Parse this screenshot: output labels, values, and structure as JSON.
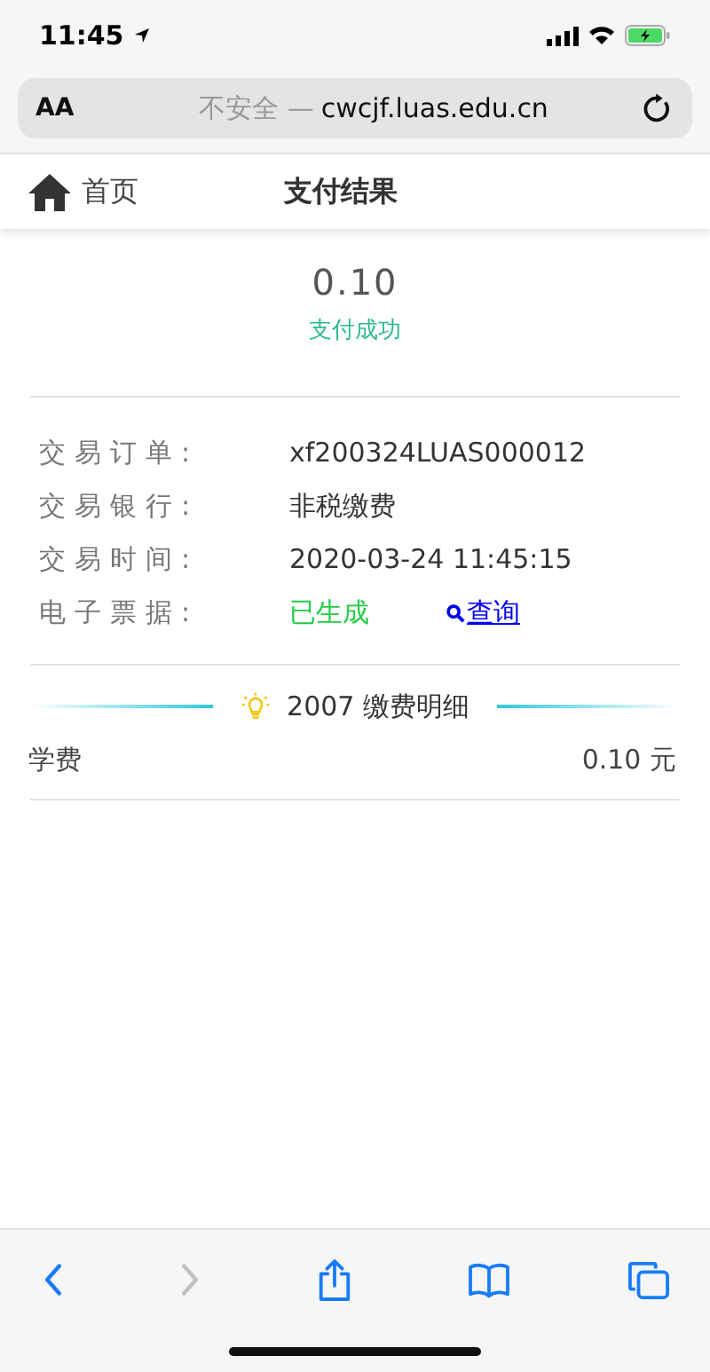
{
  "status_bar": {
    "time": "11:45"
  },
  "address_bar": {
    "text_size": "AA",
    "security": "不安全 —",
    "domain": "cwcjf.luas.edu.cn"
  },
  "header": {
    "home": "首页",
    "title": "支付结果"
  },
  "payment": {
    "amount": "0.10",
    "result": "支付成功"
  },
  "details": [
    {
      "label": "交易订单:",
      "value": "xf200324LUAS000012",
      "kind": "text"
    },
    {
      "label": "交易银行:",
      "value": "非税缴费",
      "kind": "text"
    },
    {
      "label": "交易时间:",
      "value": "2020-03-24 11:45:15",
      "kind": "text"
    },
    {
      "label": "电子票据:",
      "value": "已生成",
      "kind": "status",
      "link": "查询"
    }
  ],
  "section": {
    "title": "2007 缴费明细"
  },
  "fees": [
    {
      "name": "学费",
      "amount": "0.10 元"
    }
  ],
  "toolbar": [
    {
      "kind": "back",
      "disabled": false
    },
    {
      "kind": "forward",
      "disabled": true
    },
    {
      "kind": "share",
      "disabled": false
    },
    {
      "kind": "bookmarks",
      "disabled": false
    },
    {
      "kind": "tabs",
      "disabled": false
    }
  ]
}
